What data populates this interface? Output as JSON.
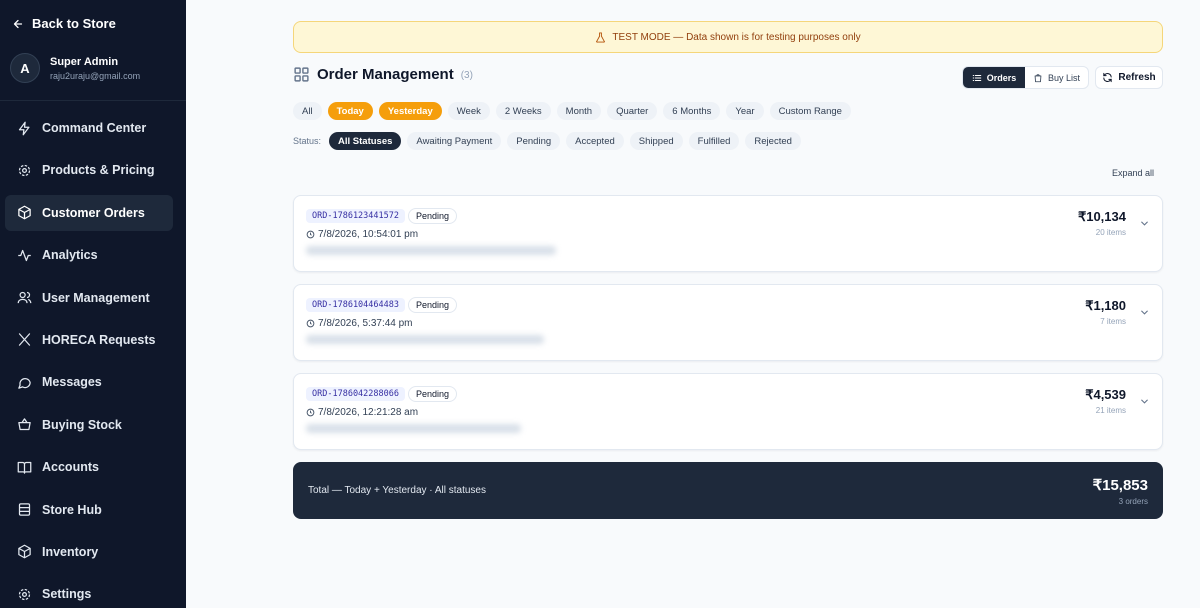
{
  "sidebar": {
    "back_label": "Back to Store",
    "profile": {
      "initial": "A",
      "name": "Super Admin",
      "email": "raju2uraju@gmail.com"
    },
    "items": [
      {
        "label": "Command Center",
        "icon": "lightning-icon"
      },
      {
        "label": "Products & Pricing",
        "icon": "gear-icon"
      },
      {
        "label": "Customer Orders",
        "icon": "package-icon",
        "active": true
      },
      {
        "label": "Analytics",
        "icon": "activity-icon"
      },
      {
        "label": "User Management",
        "icon": "users-icon"
      },
      {
        "label": "HORECA Requests",
        "icon": "utensils-icon"
      },
      {
        "label": "Messages",
        "icon": "message-icon"
      },
      {
        "label": "Buying Stock",
        "icon": "basket-icon"
      },
      {
        "label": "Accounts",
        "icon": "book-icon"
      },
      {
        "label": "Store Hub",
        "icon": "store-icon"
      },
      {
        "label": "Inventory",
        "icon": "box-icon"
      },
      {
        "label": "Settings",
        "icon": "settings-icon"
      }
    ]
  },
  "banner": {
    "text": "TEST MODE — Data shown is for testing purposes only"
  },
  "header": {
    "title": "Order Management",
    "count": "(3)"
  },
  "view_toggle": {
    "orders_label": "Orders",
    "buylist_label": "Buy List"
  },
  "refresh_label": "Refresh",
  "range_filters": [
    "All",
    "Today",
    "Yesterday",
    "Week",
    "2 Weeks",
    "Month",
    "Quarter",
    "6 Months",
    "Year",
    "Custom Range"
  ],
  "range_active": [
    "Today",
    "Yesterday"
  ],
  "status_filter": {
    "label": "Status:",
    "options": [
      "All Statuses",
      "Awaiting Payment",
      "Pending",
      "Accepted",
      "Shipped",
      "Fulfilled",
      "Rejected"
    ],
    "active": "All Statuses"
  },
  "expand_all_label": "Expand all",
  "orders": [
    {
      "id": "ORD-1786123441572",
      "status": "Pending",
      "datetime": "7/8/2026, 10:54:01 pm",
      "amount": "₹10,134",
      "items": "20 items"
    },
    {
      "id": "ORD-1786104464483",
      "status": "Pending",
      "datetime": "7/8/2026, 5:37:44 pm",
      "amount": "₹1,180",
      "items": "7 items"
    },
    {
      "id": "ORD-1786042288066",
      "status": "Pending",
      "datetime": "7/8/2026, 12:21:28 am",
      "amount": "₹4,539",
      "items": "21 items"
    }
  ],
  "total": {
    "label": "Total — Today + Yesterday · All statuses",
    "amount": "₹15,853",
    "orders": "3 orders"
  },
  "colors": {
    "sidebar_bg": "#0f172a",
    "accent_orange": "#f59e0b",
    "dark": "#1e293b",
    "banner_bg": "#fef7d6"
  }
}
